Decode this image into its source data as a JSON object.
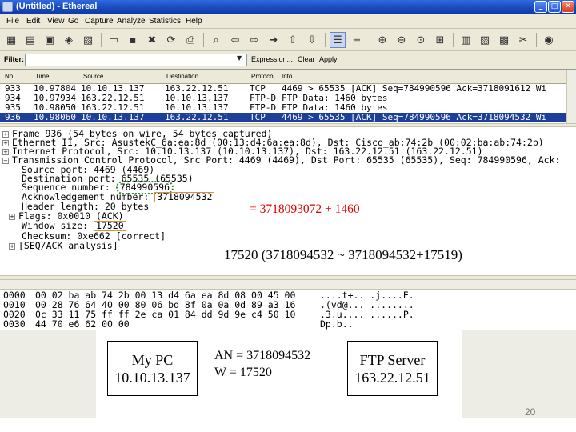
{
  "window": {
    "title": "(Untitled) - Ethereal",
    "min_symbol": "_",
    "max_symbol": "□",
    "close_symbol": "✕"
  },
  "menu": [
    "File",
    "Edit",
    "View",
    "Go",
    "Capture",
    "Analyze",
    "Statistics",
    "Help"
  ],
  "toolbar": {
    "icons": [
      "capture-interfaces-icon",
      "capture-options-icon",
      "capture-start-icon",
      "capture-stop-icon",
      "open-icon",
      "save-icon",
      "close-file-icon",
      "reload-icon",
      "print-icon",
      "find-packet-icon",
      "go-back-icon",
      "go-forward-icon",
      "go-to-packet-icon",
      "go-first-icon",
      "go-last-icon",
      "colorize-icon",
      "auto-scroll-icon",
      "zoom-in-icon",
      "zoom-out-icon",
      "zoom-normal-icon",
      "resize-columns-icon",
      "capture-filters-icon",
      "display-filters-icon",
      "preferences-icon",
      "help-icon"
    ]
  },
  "filter": {
    "label": "Filter:",
    "value": "",
    "dropdown_symbol": "▼",
    "expression_label": "Expression...",
    "clear_label": "Clear",
    "apply_label": "Apply"
  },
  "packet_list": {
    "columns": [
      "No. .",
      "Time",
      "Source",
      "Destination",
      "Protocol",
      "Info"
    ],
    "rows": [
      {
        "no": "933",
        "time": "10.97804",
        "source": "10.10.13.137",
        "destination": "163.22.12.51",
        "protocol": "TCP",
        "info": "4469 > 65535 [ACK] Seq=784990596 Ack=3718091612 Wi"
      },
      {
        "no": "934",
        "time": "10.97934",
        "source": "163.22.12.51",
        "destination": "10.10.13.137",
        "protocol": "FTP-D",
        "info": "FTP Data: 1460 bytes"
      },
      {
        "no": "935",
        "time": "10.98050",
        "source": "163.22.12.51",
        "destination": "10.10.13.137",
        "protocol": "FTP-D",
        "info": "FTP Data: 1460 bytes"
      },
      {
        "no": "936",
        "time": "10.98060",
        "source": "10.10.13.137",
        "destination": "163.22.12.51",
        "protocol": "TCP",
        "info": "4469 > 65535 [ACK] Seq=784990596 Ack=3718094532 Wi"
      }
    ]
  },
  "details": {
    "frame": "Frame 936 (54 bytes on wire, 54 bytes captured)",
    "ethernet": "Ethernet II, Src: AsustekC_6a:ea:8d (00:13:d4:6a:ea:8d), Dst: Cisco_ab:74:2b (00:02:ba:ab:74:2b)",
    "ip": "Internet Protocol, Src: 10.10.13.137 (10.10.13.137), Dst: 163.22.12.51 (163.22.12.51)",
    "tcp": "Transmission Control Protocol, Src Port: 4469 (4469), Dst Port: 65535 (65535), Seq: 784990596, Ack:",
    "src_port": "Source port: 4469 (4469)",
    "dst_port": "Destination port: 65535 (65535)",
    "seq_label": "Sequence number:",
    "seq_value": "784990596",
    "ack_label": "Acknowledgement number:",
    "ack_value": "3718094532",
    "header_length": "Header length: 20 bytes",
    "flags": "Flags: 0x0010 (ACK)",
    "window_label": "Window size:",
    "window_value": "17520",
    "checksum": "Checksum: 0xe662 [correct]",
    "seqack": "[SEQ/ACK analysis]"
  },
  "hex": [
    {
      "offset": "0000",
      "bytes": "00 02 ba ab 74 2b 00 13  d4 6a ea 8d 08 00 45 00",
      "ascii": "....t+.. .j....E."
    },
    {
      "offset": "0010",
      "bytes": "00 28 76 64 40 00 80 06  bd 8f 0a 0a 0d 89 a3 16",
      "ascii": ".(vd@... ........"
    },
    {
      "offset": "0020",
      "bytes": "0c 33 11 75 ff ff 2e ca  01 84 dd 9d 9e c4 50 10",
      "ascii": ".3.u.... ......P."
    },
    {
      "offset": "0030",
      "bytes": "44 70 e6 62 00 00",
      "ascii": "Dp.b.."
    }
  ],
  "annotations": {
    "ack_calc": "= 3718093072 + 1460",
    "window_range": "17520 (3718094532 ~ 3718094532+17519)",
    "an_line": "AN = 3718094532",
    "w_line": "W = 17520"
  },
  "boxes": {
    "left_title": "My PC",
    "left_ip": "10.10.13.137",
    "right_title": "FTP Server",
    "right_ip": "163.22.12.51"
  },
  "slide_number": "20",
  "colors": {
    "accent_red": "#e00000",
    "selected_row": "#1c3f9c",
    "highlight_green": "#2a8a2a",
    "highlight_orange": "#e08a3a"
  }
}
